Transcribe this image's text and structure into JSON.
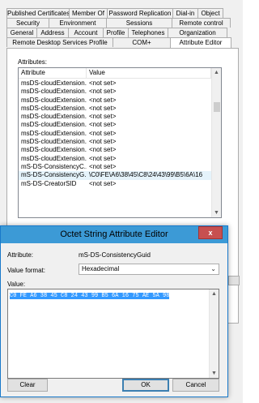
{
  "properties_dialog": {
    "tab_rows": [
      [
        "Published Certificates",
        "Member Of",
        "Password Replication",
        "Dial-in",
        "Object"
      ],
      [
        "Security",
        "Environment",
        "Sessions",
        "Remote control"
      ],
      [
        "General",
        "Address",
        "Account",
        "Profile",
        "Telephones",
        "Organization"
      ],
      [
        "Remote Desktop Services Profile",
        "COM+",
        "Attribute Editor"
      ]
    ],
    "active_tab": "Attribute Editor",
    "attributes_label": "Attributes:",
    "columns": [
      "Attribute",
      "Value"
    ],
    "rows": [
      {
        "attribute": "msDS-cloudExtension...",
        "value": "<not set>"
      },
      {
        "attribute": "msDS-cloudExtension...",
        "value": "<not set>"
      },
      {
        "attribute": "msDS-cloudExtension...",
        "value": "<not set>"
      },
      {
        "attribute": "msDS-cloudExtension...",
        "value": "<not set>"
      },
      {
        "attribute": "msDS-cloudExtension...",
        "value": "<not set>"
      },
      {
        "attribute": "msDS-cloudExtension...",
        "value": "<not set>"
      },
      {
        "attribute": "msDS-cloudExtension...",
        "value": "<not set>"
      },
      {
        "attribute": "msDS-cloudExtension...",
        "value": "<not set>"
      },
      {
        "attribute": "msDS-cloudExtension...",
        "value": "<not set>"
      },
      {
        "attribute": "msDS-cloudExtension...",
        "value": "<not set>"
      },
      {
        "attribute": "mS-DS-ConsistencyC...",
        "value": "<not set>"
      },
      {
        "attribute": "mS-DS-ConsistencyG...",
        "value": "\\C0\\FE\\A6\\38\\45\\C8\\24\\43\\99\\B5\\6A\\16"
      },
      {
        "attribute": "mS-DS-CreatorSID",
        "value": "<not set>"
      }
    ],
    "selected_row_index": 11
  },
  "octet_editor": {
    "title": "Octet String Attribute Editor",
    "close_glyph": "x",
    "attribute_label": "Attribute:",
    "attribute_value": "mS-DS-ConsistencyGuid",
    "value_format_label": "Value format:",
    "value_format_selected": "Hexadecimal",
    "value_label": "Value:",
    "value_text": "C0 FE A6 38 45 C8 24 43 99 B5 6A 16 75 AE 5A 98",
    "clear_label": "Clear",
    "ok_label": "OK",
    "cancel_label": "Cancel"
  },
  "colors": {
    "title_bar": "#3c9ad6",
    "close_button": "#c75050",
    "selection": "#3399ff",
    "row_highlight": "#e5f3fb"
  }
}
